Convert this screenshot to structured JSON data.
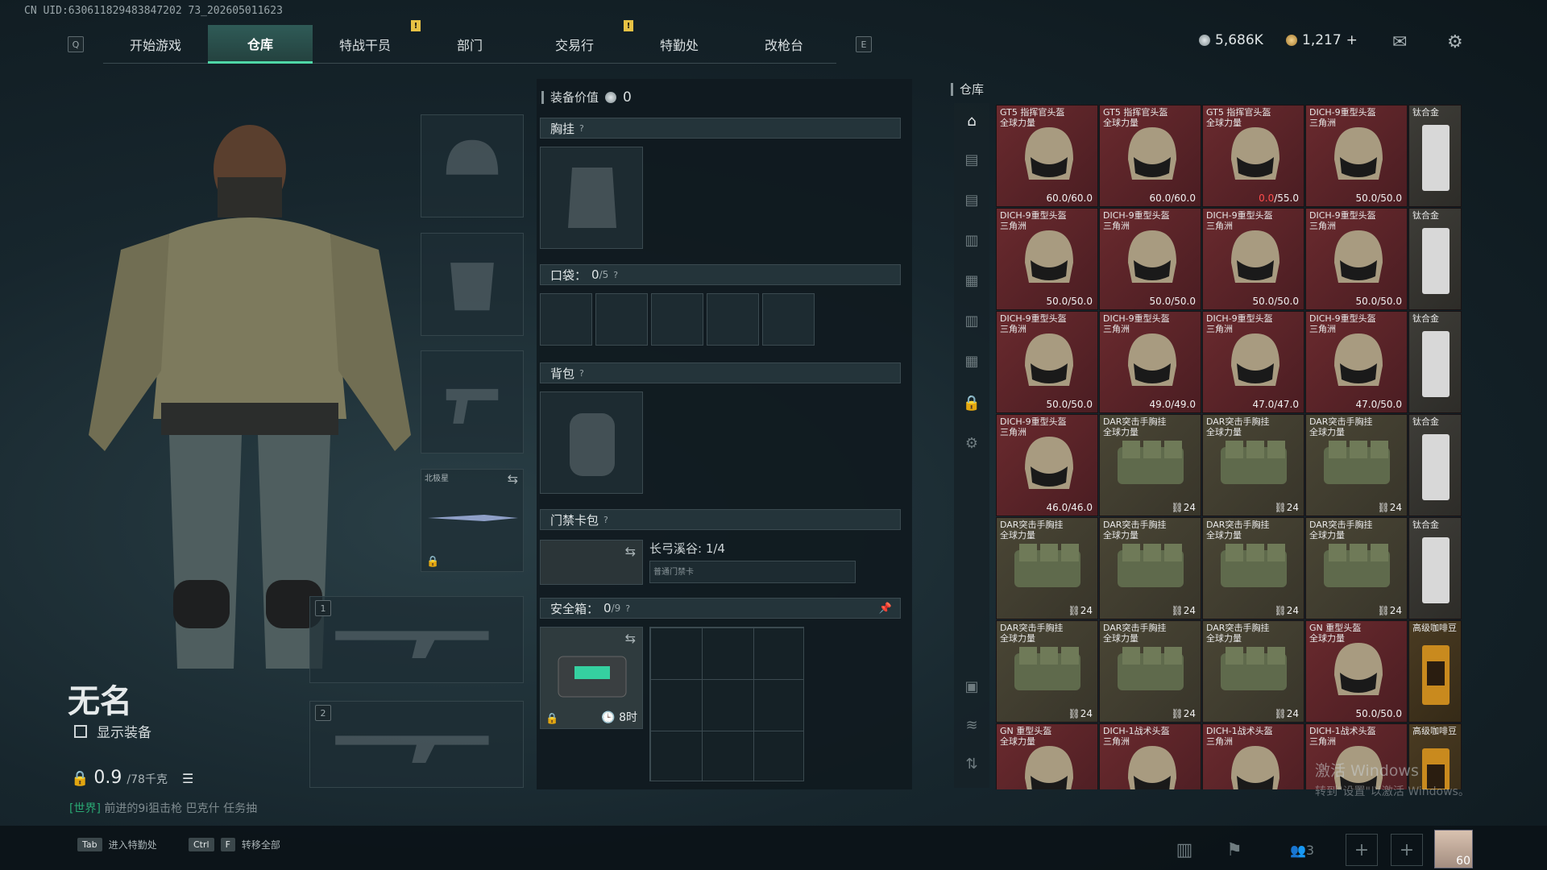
{
  "uid": "CN UID:630611829483847202 73_202605011623",
  "keys": {
    "left": "Q",
    "right": "E"
  },
  "tabs": [
    {
      "label": "开始游戏"
    },
    {
      "label": "仓库"
    },
    {
      "label": "特战干员"
    },
    {
      "label": "部门"
    },
    {
      "label": "交易行"
    },
    {
      "label": "特勤处"
    },
    {
      "label": "改枪台"
    }
  ],
  "alert_mark": "!",
  "currency": {
    "coins": "5,686K",
    "bonds": "1,217",
    "add": "+"
  },
  "character": {
    "name": "无名",
    "show_equipment": "显示装备",
    "weight_value": "0.9",
    "weight_cap": "/78千克",
    "chat_channel": "[世界]",
    "chat_text": "前进的9i狙击枪  巴克什 任务抽"
  },
  "equip_slots": {
    "melee_label": "北极星",
    "primary_index": "1",
    "secondary_index": "2"
  },
  "gear": {
    "value_label": "装备价值",
    "value": "0",
    "chest_rig": "胸挂",
    "pockets_label": "口袋：",
    "pockets_count": "0",
    "pockets_cap": "/5",
    "backpack": "背包",
    "keycard": "门禁卡包",
    "keycard_item": "长弓溪谷: 1/4",
    "keycard_sub": "普通门禁卡",
    "safebox_label": "安全箱：",
    "safebox_count": "0",
    "safebox_cap": "/9",
    "safebox_timer": "8时",
    "help": "?"
  },
  "warehouse": {
    "title": "仓库",
    "items": [
      {
        "name": "GT5 指挥官头盔\n全球力量",
        "dur": "60.0",
        "max": "/60.0",
        "type": "helmet",
        "red": false
      },
      {
        "name": "GT5 指挥官头盔\n全球力量",
        "dur": "60.0",
        "max": "/60.0",
        "type": "helmet",
        "red": false
      },
      {
        "name": "GT5 指挥官头盔\n全球力量",
        "dur": "0.0",
        "max": "/55.0",
        "type": "helmet",
        "red": true
      },
      {
        "name": "DICH-9重型头盔\n三角洲",
        "dur": "50.0",
        "max": "/50.0",
        "type": "helmet",
        "red": false
      },
      {
        "name": "DICH-9重型头盔\n三角洲",
        "dur": "50.0",
        "max": "/50.0",
        "type": "helmet",
        "red": false
      },
      {
        "name": "DICH-9重型头盔\n三角洲",
        "dur": "50.0",
        "max": "/50.0",
        "type": "helmet",
        "red": false
      },
      {
        "name": "DICH-9重型头盔\n三角洲",
        "dur": "50.0",
        "max": "/50.0",
        "type": "helmet",
        "red": false
      },
      {
        "name": "DICH-9重型头盔\n三角洲",
        "dur": "50.0",
        "max": "/50.0",
        "type": "helmet",
        "red": false
      },
      {
        "name": "DICH-9重型头盔\n三角洲",
        "dur": "50.0",
        "max": "/50.0",
        "type": "helmet",
        "red": false
      },
      {
        "name": "DICH-9重型头盔\n三角洲",
        "dur": "49.0",
        "max": "/49.0",
        "type": "helmet",
        "red": false
      },
      {
        "name": "DICH-9重型头盔\n三角洲",
        "dur": "47.0",
        "max": "/47.0",
        "type": "helmet",
        "red": false
      },
      {
        "name": "DICH-9重型头盔\n三角洲",
        "dur": "47.0",
        "max": "/50.0",
        "type": "helmet",
        "red": false
      },
      {
        "name": "DICH-9重型头盔\n三角洲",
        "dur": "46.0",
        "max": "/46.0",
        "type": "helmet",
        "red": false
      },
      {
        "name": "DAR突击手胸挂\n全球力量",
        "count": "24",
        "type": "rig"
      },
      {
        "name": "DAR突击手胸挂\n全球力量",
        "count": "24",
        "type": "rig"
      },
      {
        "name": "DAR突击手胸挂\n全球力量",
        "count": "24",
        "type": "rig"
      },
      {
        "name": "DAR突击手胸挂\n全球力量",
        "count": "24",
        "type": "rig"
      },
      {
        "name": "DAR突击手胸挂\n全球力量",
        "count": "24",
        "type": "rig"
      },
      {
        "name": "DAR突击手胸挂\n全球力量",
        "count": "24",
        "type": "rig"
      },
      {
        "name": "DAR突击手胸挂\n全球力量",
        "count": "24",
        "type": "rig"
      },
      {
        "name": "DAR突击手胸挂\n全球力量",
        "count": "24",
        "type": "rig"
      },
      {
        "name": "DAR突击手胸挂\n全球力量",
        "count": "24",
        "type": "rig"
      },
      {
        "name": "DAR突击手胸挂\n全球力量",
        "count": "24",
        "type": "rig"
      },
      {
        "name": "GN 重型头盔\n全球力量",
        "dur": "50.0",
        "max": "/50.0",
        "type": "helmet",
        "red": false
      },
      {
        "name": "GN 重型头盔\n全球力量",
        "dur": "",
        "max": "",
        "type": "helmet",
        "red": false
      },
      {
        "name": "DICH-1战术头盔\n三角洲",
        "dur": "",
        "max": "",
        "type": "helmet",
        "red": false
      },
      {
        "name": "DICH-1战术头盔\n三角洲",
        "dur": "",
        "max": "",
        "type": "helmet",
        "red": false
      },
      {
        "name": "DICH-1战术头盔\n三角洲",
        "dur": "",
        "max": "",
        "type": "helmet",
        "red": false
      }
    ],
    "side_column": [
      {
        "name": "钛合金",
        "type": "plate"
      },
      {
        "name": "钛合金",
        "type": "plate"
      },
      {
        "name": "钛合金",
        "type": "plate"
      },
      {
        "name": "钛合金",
        "type": "plate"
      },
      {
        "name": "钛合金",
        "type": "plate"
      },
      {
        "name": "高级咖啡豆",
        "type": "coffee"
      },
      {
        "name": "高级咖啡豆",
        "type": "coffee"
      }
    ]
  },
  "watermark": {
    "line1": "激活 Windows",
    "line2": "转到\"设置\"以激活 Windows。"
  },
  "bottom": {
    "hint1_key": "Tab",
    "hint1_text": "进入特勤处",
    "hint2_key1": "Ctrl",
    "hint2_key2": "F",
    "hint2_text": "转移全部",
    "squad_count": "3",
    "level": "60"
  }
}
